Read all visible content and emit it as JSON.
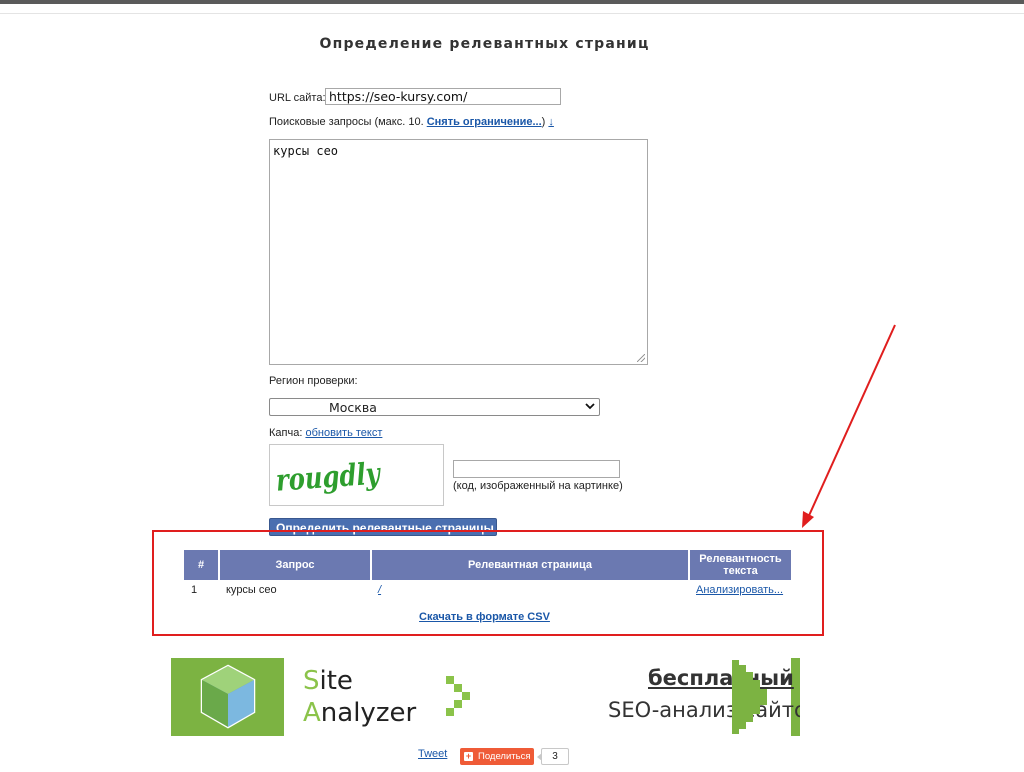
{
  "form": {
    "title": "Определение релевантных страниц",
    "url_label": "URL сайта:",
    "url_value": "https://seo-kursy.com/",
    "queries_label_prefix": "Поисковые запросы (макс. 10.",
    "queries_limit_link": "Снять ограничение...",
    "queries_label_suffix": ")",
    "queries_arrow": "↓",
    "queries_value": "курсы сео",
    "region_label": "Регион проверки:",
    "region_value": "Москва",
    "captcha_label": "Капча:",
    "captcha_refresh": "обновить текст",
    "captcha_text": "rougdly",
    "captcha_hint": "(код, изображенный на картинке)",
    "submit_label": "Определить релевантные страницы"
  },
  "results": {
    "headers": [
      "#",
      "Запрос",
      "Релевантная страница",
      "Релевантность текста"
    ],
    "rows": [
      {
        "num": "1",
        "query": "курсы сео",
        "page": "/",
        "analyze": "Анализировать..."
      }
    ],
    "csv_link": "Скачать в формате CSV"
  },
  "banner": {
    "site_first": "S",
    "site_rest": "ite",
    "analyzer_first": "A",
    "analyzer_rest": "nalyzer",
    "free": "бесплатный",
    "seo": "SEO-анализ сайтов"
  },
  "social": {
    "tweet": "Tweet",
    "share": "Поделиться",
    "share_count": "3"
  },
  "colors": {
    "header_bg": "#6b79b1",
    "button_bg": "#4a6fb0",
    "link": "#1a57a8",
    "highlight": "#e01e1e",
    "banner_green": "#7cb342",
    "share_orange": "#ef5b37"
  }
}
